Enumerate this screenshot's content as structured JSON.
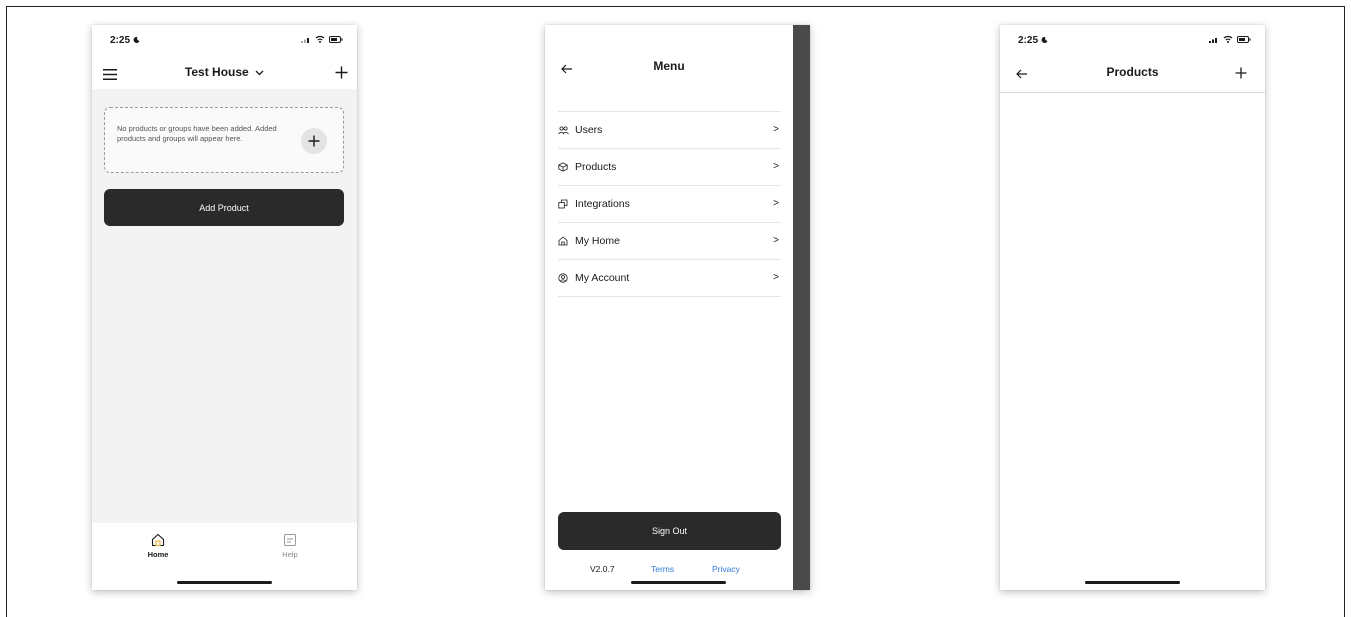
{
  "screen1": {
    "status_time": "2:25",
    "title": "Test House",
    "empty_message": "No products or groups have been added. Added products and groups will appear here.",
    "add_product_label": "Add Product",
    "tabs": [
      {
        "label": "Home",
        "icon": "home-icon",
        "active": true
      },
      {
        "label": "Help",
        "icon": "help-icon",
        "active": false
      }
    ]
  },
  "screen2": {
    "title": "Menu",
    "items": [
      {
        "label": "Users",
        "icon": "users-icon"
      },
      {
        "label": "Products",
        "icon": "box-icon"
      },
      {
        "label": "Integrations",
        "icon": "integrations-icon"
      },
      {
        "label": "My Home",
        "icon": "home-icon"
      },
      {
        "label": "My Account",
        "icon": "account-icon"
      }
    ],
    "sign_out_label": "Sign Out",
    "version": "V2.0.7",
    "terms_label": "Terms",
    "privacy_label": "Privacy"
  },
  "screen3": {
    "status_time": "2:25",
    "title": "Products"
  },
  "colors": {
    "primary_button": "#2a2a2a",
    "link": "#2f7bdc",
    "active_tab_accent": "#e8b13a",
    "content_bg": "#f3f3f3",
    "overlay": "#4a4a4a"
  }
}
